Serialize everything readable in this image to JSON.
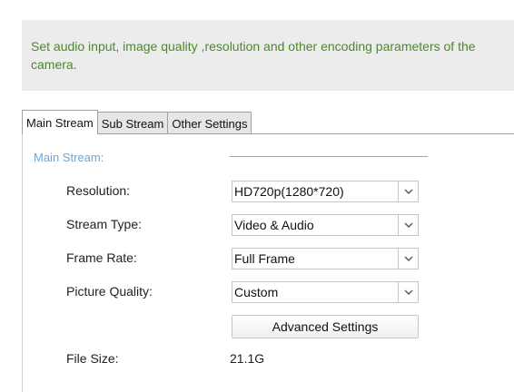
{
  "info": {
    "text": "Set audio input, image quality ,resolution and other encoding parameters of the camera."
  },
  "tabs": [
    {
      "label": "Main Stream",
      "active": true
    },
    {
      "label": "Sub Stream",
      "active": false
    },
    {
      "label": "Other Settings",
      "active": false
    }
  ],
  "section": {
    "title": "Main Stream:"
  },
  "fields": {
    "resolution": {
      "label": "Resolution:",
      "value": "HD720p(1280*720)"
    },
    "stream_type": {
      "label": "Stream Type:",
      "value": "Video & Audio"
    },
    "frame_rate": {
      "label": "Frame Rate:",
      "value": "Full Frame"
    },
    "picture_quality": {
      "label": "Picture Quality:",
      "value": "Custom"
    },
    "advanced_button": {
      "label": "Advanced Settings"
    },
    "file_size": {
      "label": "File Size:",
      "value": "21.1G"
    }
  },
  "icons": {
    "dropdown": "chevron-down-icon"
  },
  "colors": {
    "info_text": "#4a8a2a",
    "info_background": "#ececec",
    "section_title": "#6aa6d8"
  }
}
